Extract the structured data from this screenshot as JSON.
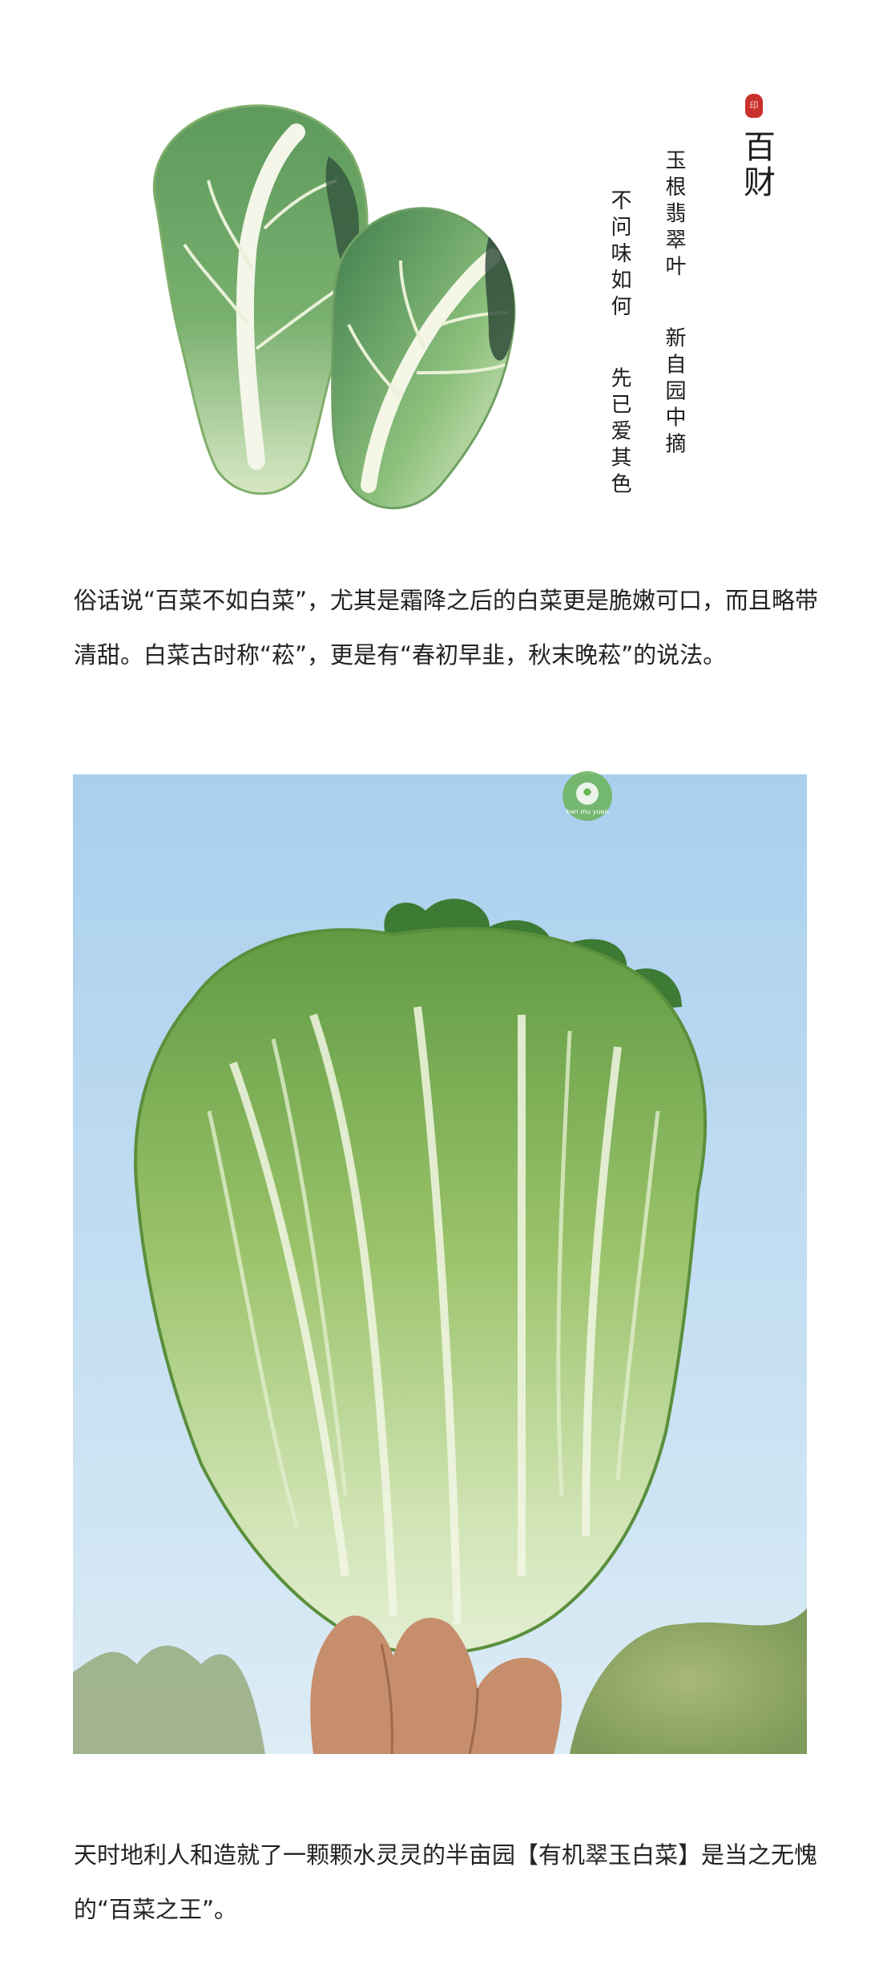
{
  "poem": {
    "seal_char": "印",
    "title": "百财",
    "line1_a": "玉根翡翠叶",
    "line1_b": "新自园中摘",
    "line2_a": "不问味如何",
    "line2_b": "先已爱其色"
  },
  "paragraph1": "俗话说“百菜不如白菜”，尤其是霜降之后的白菜更是脆嫩可口，而且略带清甜。白菜古时称“菘”，更是有“春初早韭，秋末晚菘”的说法。",
  "watermark": {
    "text": "ban mu yuan"
  },
  "paragraph2": "天时地利人和造就了一颗颗水灵灵的半亩园【有机翠玉白菜】是当之无愧的“百菜之王”。",
  "colors": {
    "sky_top": "#a9cfee",
    "sky_bottom": "#dcecf5",
    "cabbage_dark": "#4f8b3a",
    "cabbage_light": "#cfe3b2",
    "seal_red": "#c9302c"
  }
}
